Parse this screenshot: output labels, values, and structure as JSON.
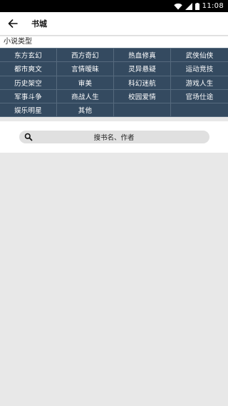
{
  "status_bar": {
    "time": "11:08"
  },
  "app_bar": {
    "title": "书城"
  },
  "section": {
    "title": "小说类型"
  },
  "categories": [
    "东方玄幻",
    "西方奇幻",
    "热血修真",
    "武侠仙侠",
    "都市爽文",
    "言情暧昧",
    "灵异悬疑",
    "运动竞技",
    "历史架空",
    "审美",
    "科幻迷航",
    "游戏人生",
    "军事斗争",
    "商战人生",
    "校园爱情",
    "官场仕途",
    "娱乐明星",
    "其他"
  ],
  "search": {
    "placeholder": "搜书名、作者"
  },
  "colors": {
    "category_bg": "#344a60",
    "status_bar_bg": "#000000",
    "page_bg": "#e8e8e8"
  },
  "icons": [
    "wifi-icon",
    "signal-icon",
    "battery-icon",
    "back-arrow-icon",
    "search-icon"
  ]
}
